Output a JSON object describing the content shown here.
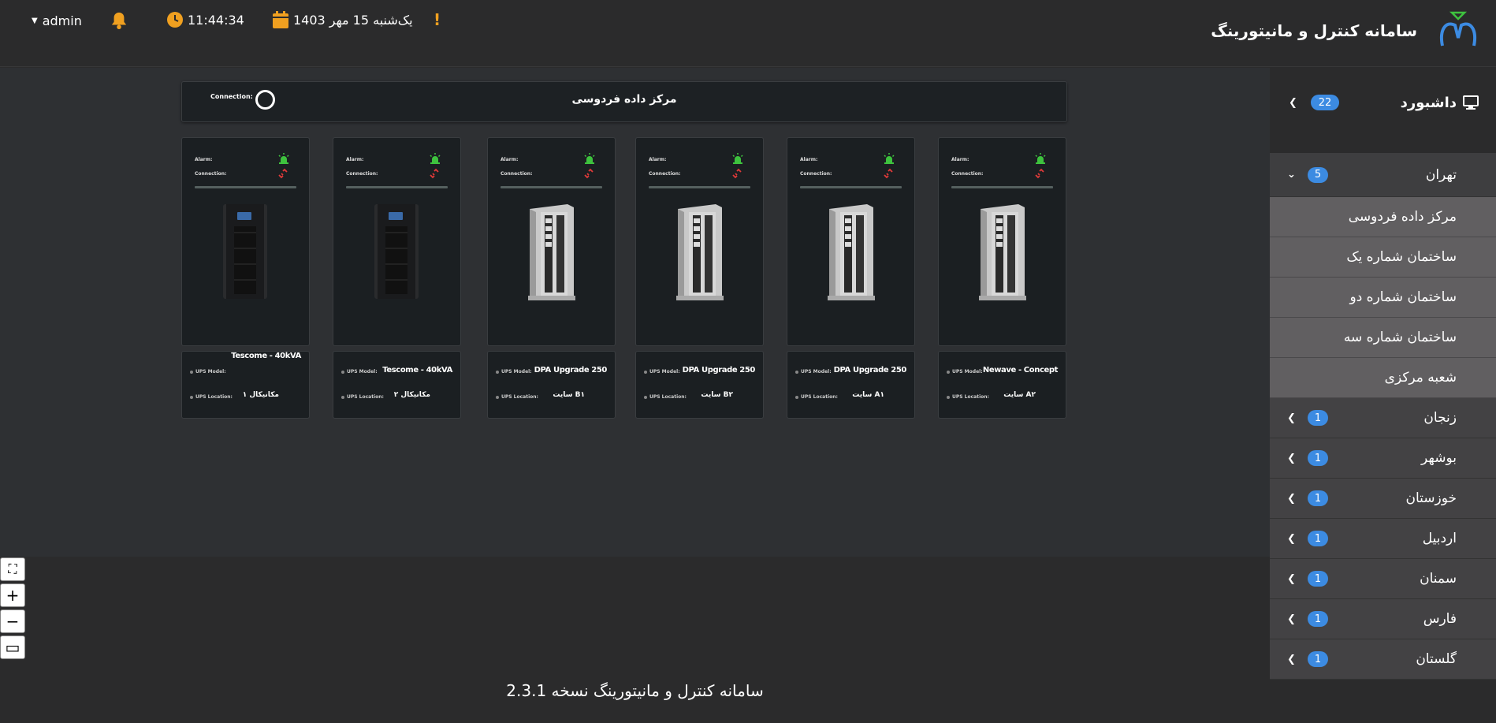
{
  "header": {
    "user": "admin",
    "time": "11:44:34",
    "date": "یک‌شنبه 15 مهر 1403",
    "alert": "!",
    "brand_title": "سامانه کنترل و مانیتورینگ"
  },
  "site": {
    "title": "مرکز داده فردوسی",
    "connection_label": "Connection:"
  },
  "card_labels": {
    "alarm": "Alarm:",
    "connection": "Connection:",
    "ups_model": "UPS Model:",
    "ups_location": "UPS Location:"
  },
  "cards": [
    {
      "model": "Tescome - 40kVA",
      "location": "مکانیکال ۱"
    },
    {
      "model": "Tescome - 40kVA",
      "location": "مکانیکال ۲"
    },
    {
      "model": "DPA Upgrade 250",
      "location": "سایت B۱"
    },
    {
      "model": "DPA Upgrade 250",
      "location": "سایت B۲"
    },
    {
      "model": "DPA Upgrade 250",
      "location": "سایت A۱"
    },
    {
      "model": "Newave - Concept",
      "location": "سایت A۲"
    }
  ],
  "zoom": {
    "fullscreen": "⛶",
    "zoom_in": "+",
    "zoom_out": "−",
    "fit": "▭"
  },
  "footer": "سامانه کنترل و مانیتورینگ نسخه 2.3.1",
  "sidebar": {
    "dashboard": {
      "label": "داشبورد",
      "count": "22"
    },
    "tehran": {
      "label": "تهران",
      "count": "5"
    },
    "tehran_sites": [
      "مرکز داده فردوسی",
      "ساختمان شماره یک",
      "ساختمان شماره دو",
      "ساختمان شماره سه",
      "شعبه مرکزی"
    ],
    "provinces": [
      {
        "label": "زنجان",
        "count": "1"
      },
      {
        "label": "بوشهر",
        "count": "1"
      },
      {
        "label": "خوزستان",
        "count": "1"
      },
      {
        "label": "اردبیل",
        "count": "1"
      },
      {
        "label": "سمنان",
        "count": "1"
      },
      {
        "label": "فارس",
        "count": "1"
      },
      {
        "label": "گلستان",
        "count": "1"
      }
    ]
  },
  "colors": {
    "accent": "#f0a020",
    "badge": "#3c8be2",
    "alarm_green": "#3ec23e",
    "link_red": "#e03a3a"
  }
}
